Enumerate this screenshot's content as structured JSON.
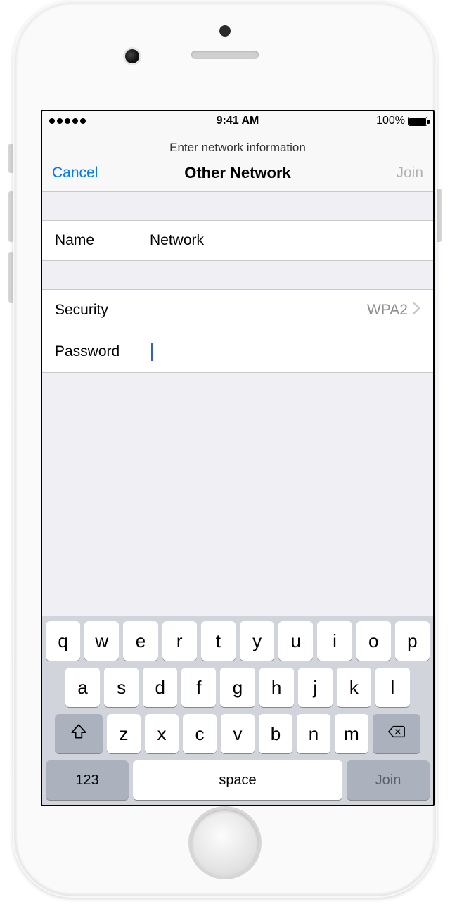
{
  "status_bar": {
    "time": "9:41 AM",
    "battery_pct": "100%"
  },
  "nav": {
    "subtitle": "Enter network information",
    "cancel": "Cancel",
    "title": "Other Network",
    "join": "Join"
  },
  "form": {
    "name_label": "Name",
    "name_value": "Network",
    "security_label": "Security",
    "security_value": "WPA2",
    "password_label": "Password",
    "password_value": ""
  },
  "keyboard": {
    "row1": [
      "q",
      "w",
      "e",
      "r",
      "t",
      "y",
      "u",
      "i",
      "o",
      "p"
    ],
    "row2": [
      "a",
      "s",
      "d",
      "f",
      "g",
      "h",
      "j",
      "k",
      "l"
    ],
    "row3": [
      "z",
      "x",
      "c",
      "v",
      "b",
      "n",
      "m"
    ],
    "numbers_key": "123",
    "space_key": "space",
    "return_key": "Join"
  }
}
